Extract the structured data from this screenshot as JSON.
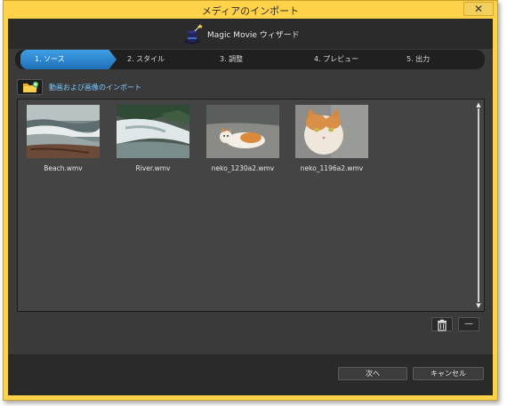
{
  "window": {
    "title": "メディアのインポート",
    "close_glyph": "✕"
  },
  "header": {
    "app_title": "Magic Movie ウィザード"
  },
  "steps": [
    {
      "label": "1. ソース"
    },
    {
      "label": "2. スタイル"
    },
    {
      "label": "3. 調整"
    },
    {
      "label": "4. プレビュー"
    },
    {
      "label": "5. 出力"
    }
  ],
  "import": {
    "label": "動画および画像のインポート",
    "icon": "folder-add-icon"
  },
  "media": [
    {
      "name": "Beach.wmv",
      "kind": "beach-video-thumbnail"
    },
    {
      "name": "River.wmv",
      "kind": "river-video-thumbnail"
    },
    {
      "name": "neko_1230a2.wmv",
      "kind": "cat-lying-thumbnail"
    },
    {
      "name": "neko_1196a2.wmv",
      "kind": "cat-face-thumbnail"
    }
  ],
  "tools": {
    "delete_icon": "trash-icon",
    "remove_glyph": "—"
  },
  "footer": {
    "next_label": "次へ",
    "cancel_label": "キャンセル"
  },
  "colors": {
    "accent": "#2a84d2",
    "frame": "#ffd24a",
    "link": "#7ec8ff"
  }
}
